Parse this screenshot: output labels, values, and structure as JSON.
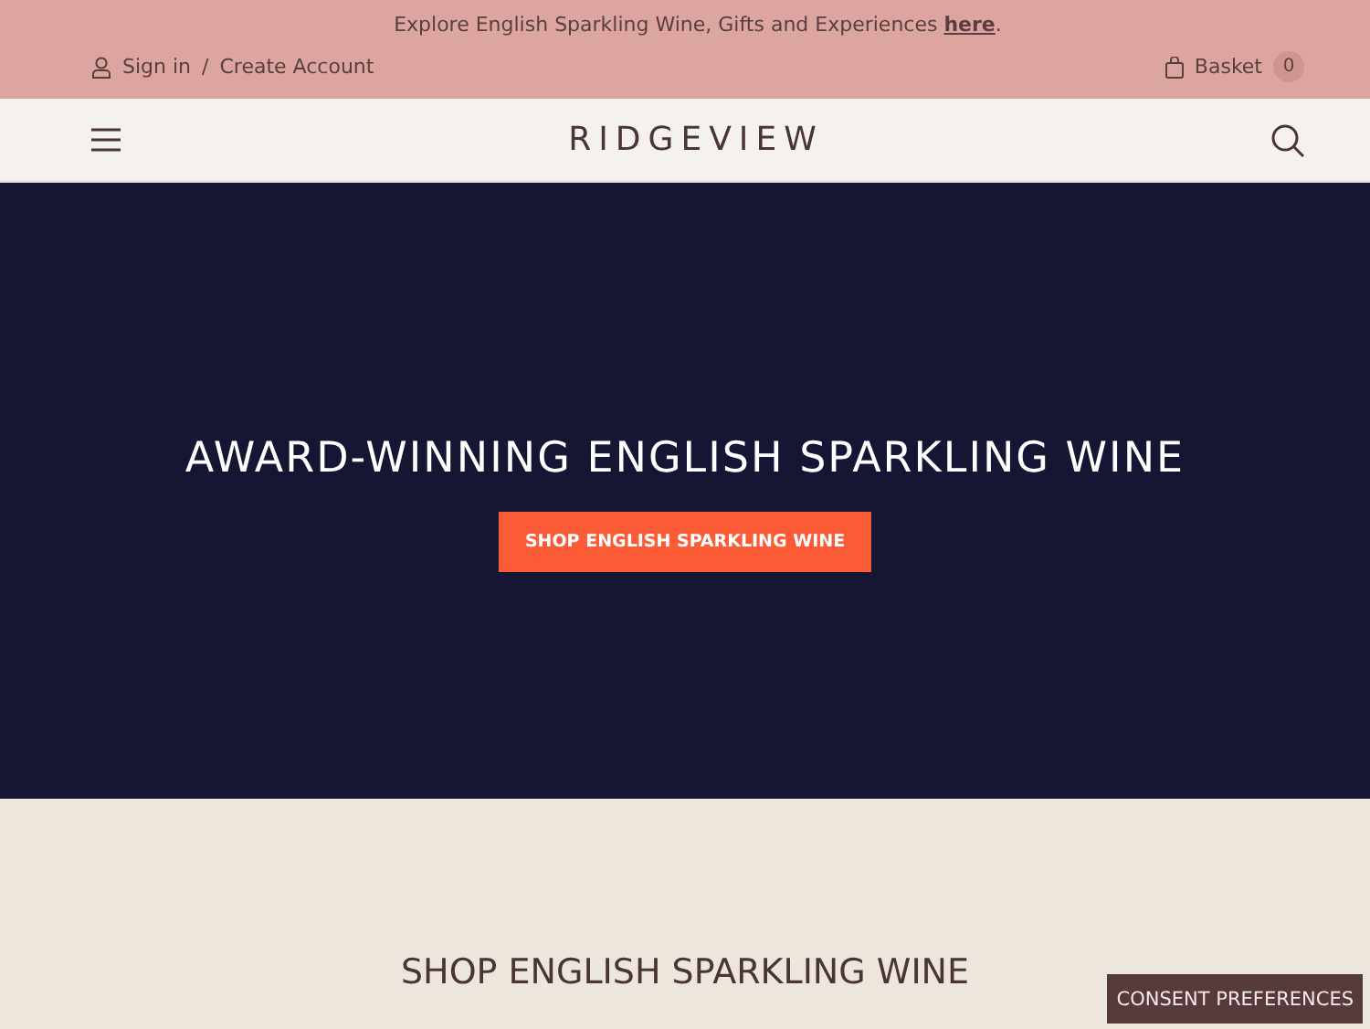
{
  "announcement": {
    "text": "Explore English Sparkling Wine, Gifts and Experiences ",
    "link": "here",
    "end": "."
  },
  "account": {
    "sign_in": "Sign in",
    "separator": "/",
    "create": "Create Account"
  },
  "basket": {
    "label": "Basket",
    "count": "0"
  },
  "logo": "RIDGEVIEW",
  "hero": {
    "title": "AWARD-WINNING ENGLISH SPARKLING WINE",
    "button": "SHOP ENGLISH SPARKLING WINE"
  },
  "section": {
    "title": "SHOP ENGLISH SPARKLING WINE"
  },
  "consent_button": "CONSENT PREFERENCES"
}
